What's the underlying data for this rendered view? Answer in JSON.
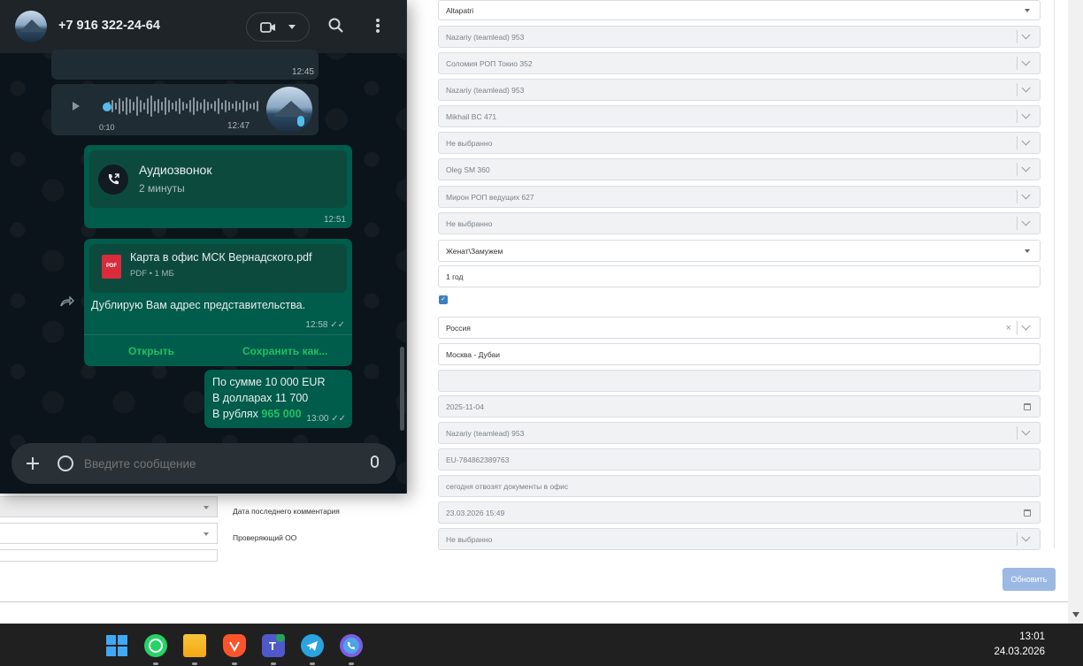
{
  "crm": {
    "fields": [
      {
        "value": "Altapatri",
        "type": "select",
        "disabled": false
      },
      {
        "value": "Nazariy (teamlead) 953",
        "type": "select2",
        "disabled": true
      },
      {
        "value": "Соломия РОП Токио 352",
        "type": "select2",
        "disabled": true
      },
      {
        "value": "Nazariy (teamlead) 953",
        "type": "select2",
        "disabled": true
      },
      {
        "value": "Mikhail BC 471",
        "type": "select2",
        "disabled": true
      },
      {
        "value": "Не выбранно",
        "type": "select2",
        "disabled": true
      },
      {
        "value": "Oleg SM 360",
        "type": "select2",
        "disabled": true
      },
      {
        "value": "Мирон РОП ведущих 627",
        "type": "select2",
        "disabled": true
      },
      {
        "value": "Не выбранно",
        "type": "select2",
        "disabled": true
      },
      {
        "value": "Женат\\Замужем",
        "type": "select",
        "disabled": false
      },
      {
        "value": "1 год",
        "type": "text",
        "disabled": false
      },
      {
        "value": "Россия",
        "type": "select2-clear",
        "disabled": false
      },
      {
        "value": "Москва - Дубаи",
        "type": "text",
        "disabled": false
      },
      {
        "value": "",
        "type": "text",
        "disabled": true
      },
      {
        "value": "2025-11-04",
        "type": "date",
        "disabled": true
      },
      {
        "value": "Nazariy (teamlead) 953",
        "type": "select2",
        "disabled": true
      },
      {
        "value": "EU-784862389763",
        "type": "text",
        "disabled": true
      },
      {
        "value": "сегодня отвозят документы в офис",
        "type": "text",
        "disabled": true
      },
      {
        "value": "23.03.2026 15:49",
        "type": "date",
        "disabled": true
      },
      {
        "value": "Не выбранно",
        "type": "select2",
        "disabled": true
      }
    ],
    "checkbox_checked": true,
    "labels": {
      "last_comment_date": "Дата последнего комментария",
      "checker_oo": "Проверяющий ОО"
    },
    "update_button": "Обновить"
  },
  "whatsapp": {
    "contact": "+7 916 322-24-64",
    "prev_time": "12:45",
    "voice": {
      "elapsed": "0:10",
      "time": "12:47"
    },
    "call": {
      "title": "Аудиозвонок",
      "duration": "2 минуты",
      "time": "12:51"
    },
    "pdf": {
      "name": "Карта в офис МСК Вернадского.pdf",
      "meta": "PDF • 1 МБ",
      "icon_label": "PDF",
      "caption": "Дублирую Вам адрес представительства.",
      "time": "12:58",
      "open": "Открыть",
      "save": "Сохранить как..."
    },
    "sum_msg": {
      "line1": "По сумме 10 000 EUR",
      "line2": "В долларах 11 700",
      "line3_prefix": "В рублях ",
      "line3_amount": "965 000",
      "time": "13:00"
    },
    "composer_placeholder": "Введите сообщение"
  },
  "taskbar": {
    "apps": [
      "windows-start",
      "whatsapp",
      "file-explorer",
      "brave",
      "teams",
      "telegram",
      "viber"
    ],
    "time": "13:01",
    "date": "24.03.2026"
  },
  "colors": {
    "wa_green": "#21c063",
    "wa_out_bubble": "#005c4b",
    "wa_in_bubble": "#202c33",
    "crm_button": "#9bb9e3"
  }
}
